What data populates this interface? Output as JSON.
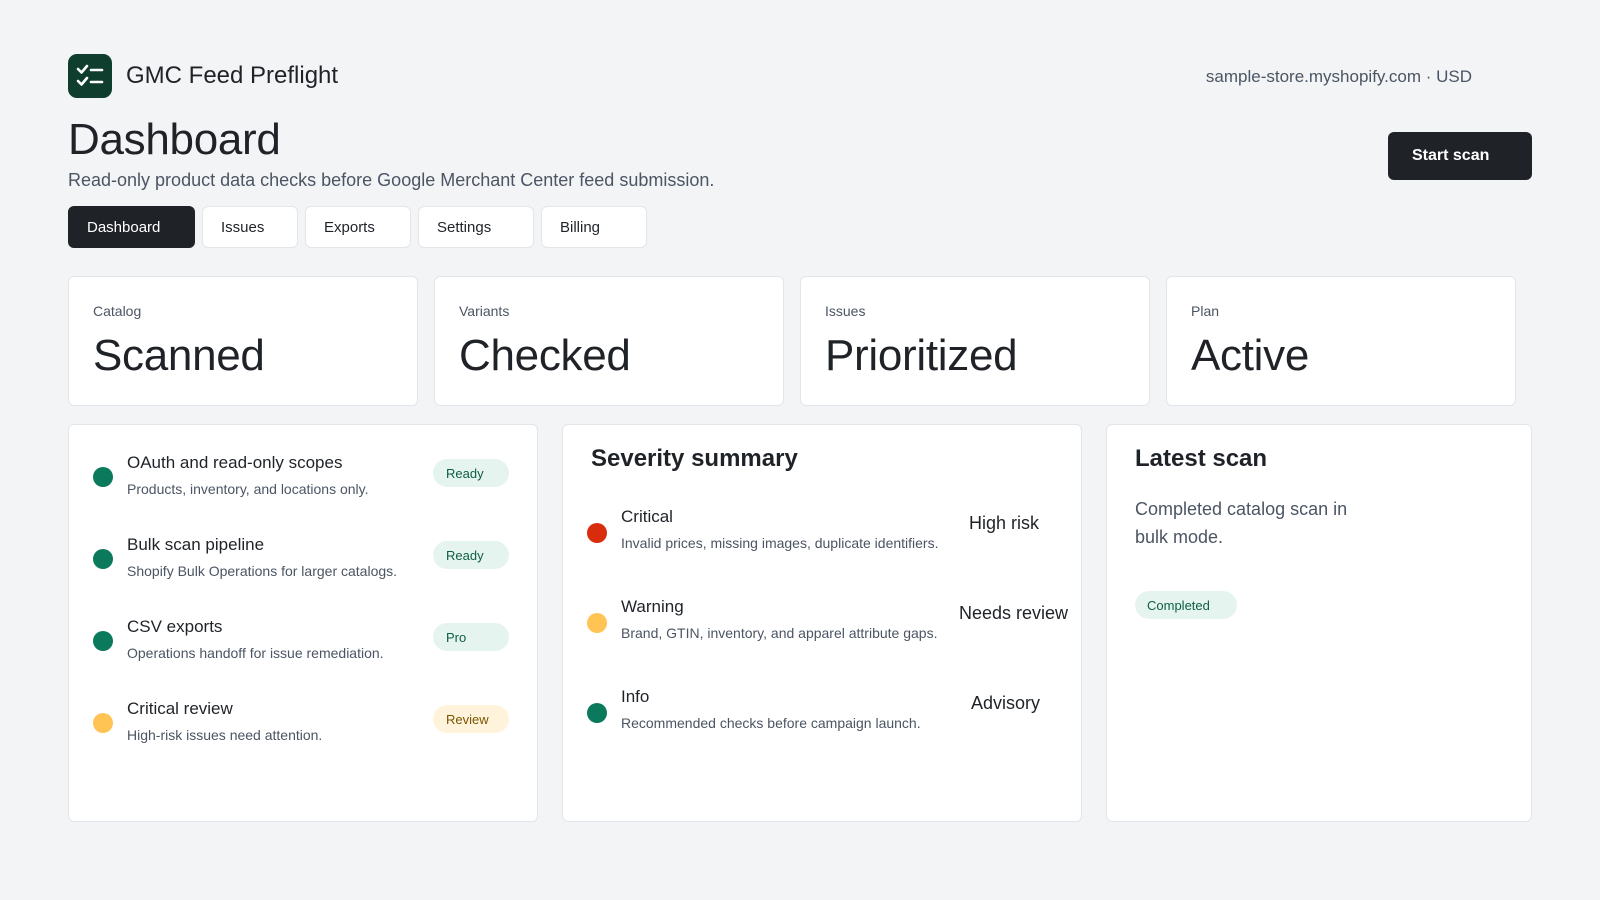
{
  "app": {
    "name": "GMC Feed Preflight",
    "store": "sample-store.myshopify.com · USD",
    "logo_icon": "checklist-icon"
  },
  "page": {
    "title": "Dashboard",
    "subtitle": "Read-only product data checks before Google Merchant Center feed submission.",
    "primary_action": "Start scan"
  },
  "tabs": [
    {
      "label": "Dashboard",
      "active": true
    },
    {
      "label": "Issues",
      "active": false
    },
    {
      "label": "Exports",
      "active": false
    },
    {
      "label": "Settings",
      "active": false
    },
    {
      "label": "Billing",
      "active": false
    }
  ],
  "stats": [
    {
      "label": "Catalog",
      "value": "Scanned"
    },
    {
      "label": "Variants",
      "value": "Checked"
    },
    {
      "label": "Issues",
      "value": "Prioritized"
    },
    {
      "label": "Plan",
      "value": "Active"
    }
  ],
  "checklist": [
    {
      "title": "OAuth and read-only scopes",
      "description": "Products, inventory, and locations only.",
      "badge": "Ready",
      "status": "green"
    },
    {
      "title": "Bulk scan pipeline",
      "description": "Shopify Bulk Operations for larger catalogs.",
      "badge": "Ready",
      "status": "green"
    },
    {
      "title": "CSV exports",
      "description": "Operations handoff for issue remediation.",
      "badge": "Pro",
      "status": "green"
    },
    {
      "title": "Critical review",
      "description": "High-risk issues need attention.",
      "badge": "Review",
      "status": "yellow"
    }
  ],
  "severity": {
    "heading": "Severity summary",
    "items": [
      {
        "title": "Critical",
        "description": "Invalid prices, missing images, duplicate identifiers.",
        "risk": "High risk",
        "status": "red"
      },
      {
        "title": "Warning",
        "description": "Brand, GTIN, inventory, and apparel attribute gaps.",
        "risk": "Needs review",
        "status": "yellow"
      },
      {
        "title": "Info",
        "description": "Recommended checks before campaign launch.",
        "risk": "Advisory",
        "status": "green"
      }
    ]
  },
  "latest_scan": {
    "heading": "Latest scan",
    "text": "Completed catalog scan in bulk mode.",
    "badge": "Completed"
  },
  "colors": {
    "brand": "#0f3d2e",
    "primary_button": "#1f2328",
    "success": "#0b7a5c",
    "warning": "#ffc453",
    "critical": "#d82c0d",
    "background": "#f3f4f6"
  }
}
